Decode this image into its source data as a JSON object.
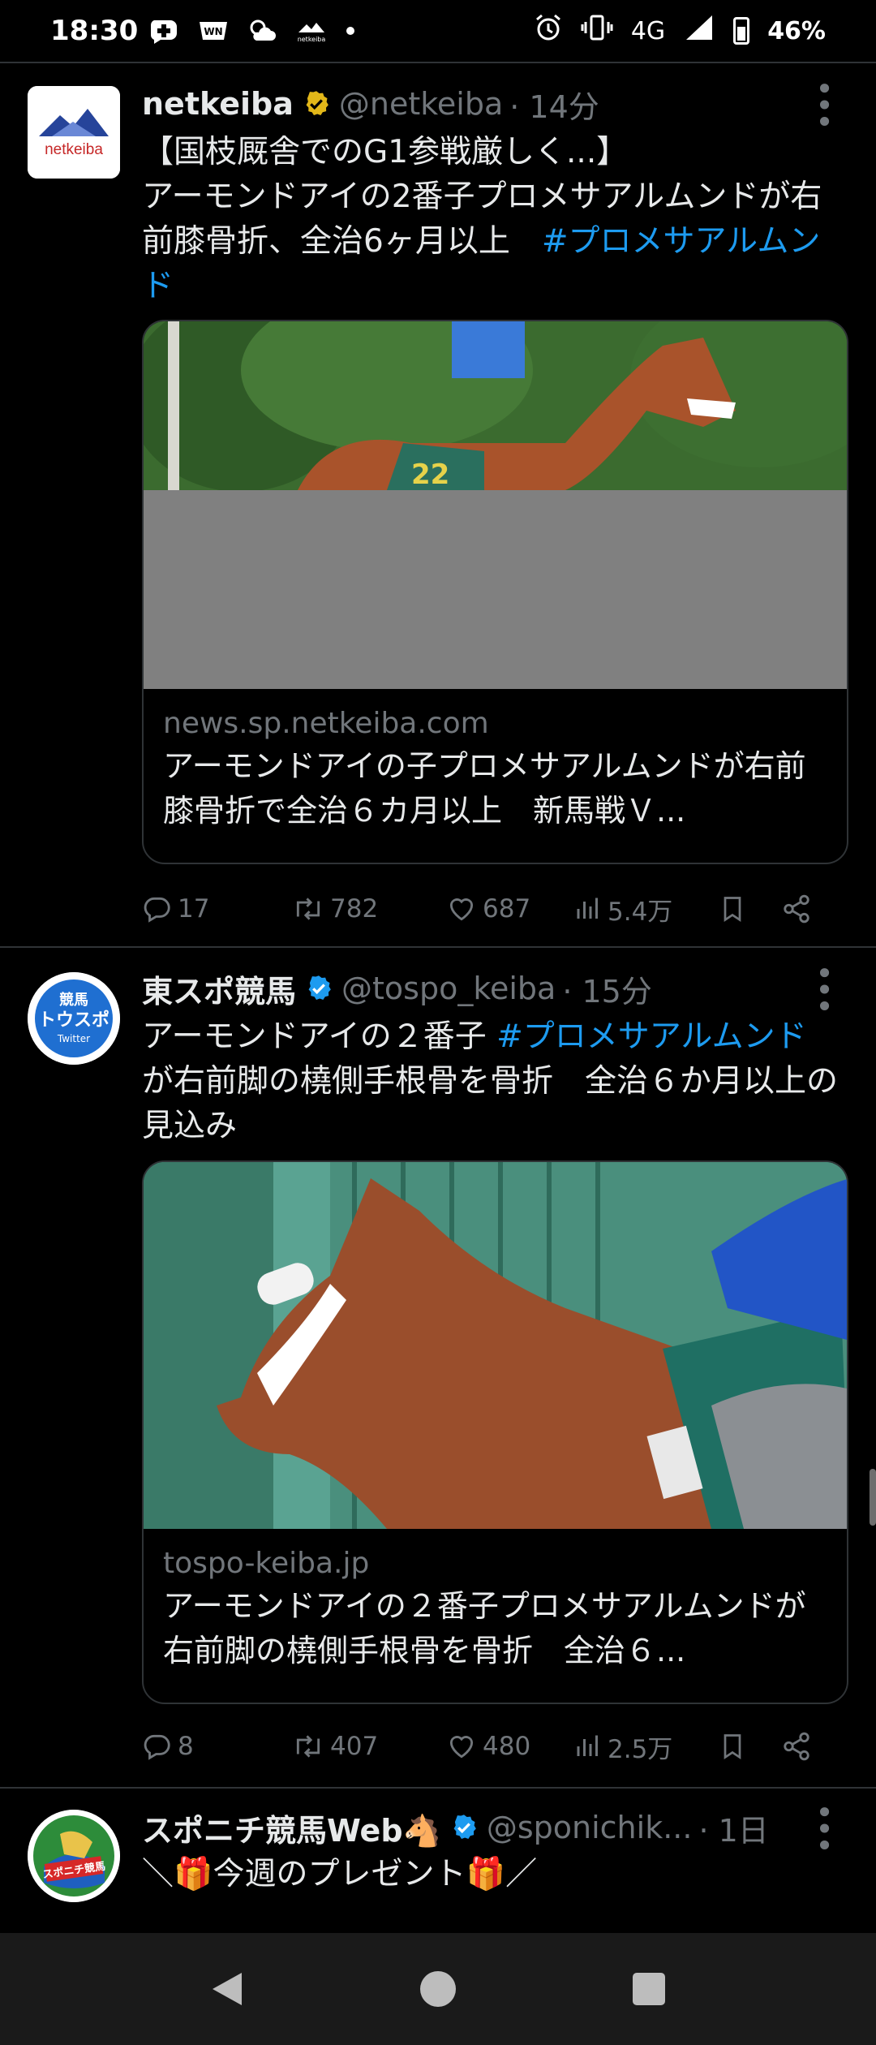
{
  "status_bar": {
    "time": "18:30",
    "network": "4G",
    "battery": "46%",
    "battery_level": 0.46,
    "left_icons": [
      "medical-cross-icon",
      "weather-news-icon",
      "cloud-sun-icon",
      "netkeiba-app-icon",
      "dot-icon"
    ],
    "right_icons": [
      "alarm-icon",
      "vibrate-icon",
      "signal-icon",
      "battery-icon"
    ]
  },
  "colors": {
    "background": "#000000",
    "link": "#1d9bf0",
    "muted": "#71767b",
    "verified_gold": "#e2b719",
    "verified_blue": "#1d9bf0",
    "divider": "#2f3336"
  },
  "tweets": [
    {
      "name": "netkeiba",
      "handle": "@netkeiba",
      "time": "· 14分",
      "verified": "gold",
      "avatar_label": "netkeiba",
      "text_line1": "【国枝厩舎でのG1参戦厳しく...】",
      "text_line2": "アーモンドアイの2番子プロメサアルムンドが右前膝骨折、全治6ヶ月以上　",
      "hashtag": "#プロメサアルムンド",
      "card_domain": "news.sp.netkeiba.com",
      "card_title": "アーモンドアイの子プロメサアルムンドが右前膝骨折で全治６カ月以上　新馬戦Ｖ...",
      "card_image_number": "22",
      "replies": "17",
      "retweets": "782",
      "likes": "687",
      "views": "5.4万"
    },
    {
      "name": "東スポ競馬",
      "handle": "@tospo_keiba",
      "time": "· 15分",
      "verified": "blue",
      "avatar_line1": "競馬",
      "avatar_line2": "トウスポ",
      "avatar_line3": "Twitter",
      "text_pre": "アーモンドアイの２番子 ",
      "hashtag": "#プロメサアルムンド",
      "text_post": " が右前脚の橈側手根骨を骨折　全治６か月以上の見込み",
      "card_domain": "tospo-keiba.jp",
      "card_title": "アーモンドアイの２番子プロメサアルムンドが右前脚の橈側手根骨を骨折　全治６...",
      "replies": "8",
      "retweets": "407",
      "likes": "480",
      "views": "2.5万"
    },
    {
      "name": "スポニチ競馬Web🐴",
      "handle": "@sponichik...",
      "time": "· 1日",
      "verified": "blue",
      "avatar_label": "スポニチ競馬",
      "text": "＼🎁今週のプレゼント🎁／"
    }
  ],
  "nav": [
    "back-icon",
    "home-icon",
    "recents-icon"
  ]
}
